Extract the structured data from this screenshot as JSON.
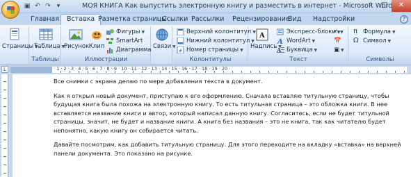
{
  "window": {
    "title": "МОЯ КНИГА Как выпустить электронную книгу и разместить в интернет - Microsoft Word (Ошибка",
    "controls": {
      "minimize": "–",
      "maximize": "□",
      "close": "✕"
    }
  },
  "tabs": [
    {
      "label": "Главная"
    },
    {
      "label": "Вставка"
    },
    {
      "label": "Разметка страницы"
    },
    {
      "label": "Ссылки"
    },
    {
      "label": "Рассылки"
    },
    {
      "label": "Рецензирование"
    },
    {
      "label": "Вид"
    },
    {
      "label": "Надстройки"
    }
  ],
  "active_tab": "Вставка",
  "ribbon": {
    "groups": {
      "pages": {
        "label": "",
        "button": "Страницы"
      },
      "tables": {
        "label": "Таблицы",
        "button": "Таблица"
      },
      "illustrations": {
        "label": "Иллюстрации",
        "picture": "Рисунок",
        "clip": "Клип",
        "shapes": "Фигуры",
        "smartart": "SmartArt",
        "chart": "Диаграмма"
      },
      "links": {
        "label": "",
        "button": "Связи"
      },
      "headers": {
        "label": "Колонтитулы",
        "header": "Верхний колонтитул",
        "footer": "Нижний колонтитул",
        "page_number": "Номер страницы"
      },
      "text": {
        "label": "Текст",
        "textbox": "Надпись",
        "quickparts": "Экспресс-блоки",
        "wordart": "WordArt",
        "dropcap": "Буквица"
      },
      "symbols": {
        "label": "Символы",
        "formula": "Формула",
        "symbol": "Символ"
      }
    }
  },
  "document": {
    "paragraphs": [
      "Все снимки с экрана делаю по мере добавления текста в документ.",
      "Как я открыл новый документ, приступаю к его оформлению. Сначала вставляю титульную страницу, чтобы будущая книга была похожа на электронную книгу. То есть титульная страница – это обложка книги. В нее вставляется название книги и автор, который написал данную книгу. Согласитесь, если не будет титульной страницы, значит, не будет и название книги. А книга без названия – это не книга, так как читателю будет непонятно, какую книгу он собирается читать.",
      "Давайте посмотрим, как добавить титульную страницу. Для этого переходите на вкладку «вставка» на верхней панели документа. Это показано на рисунке."
    ]
  }
}
